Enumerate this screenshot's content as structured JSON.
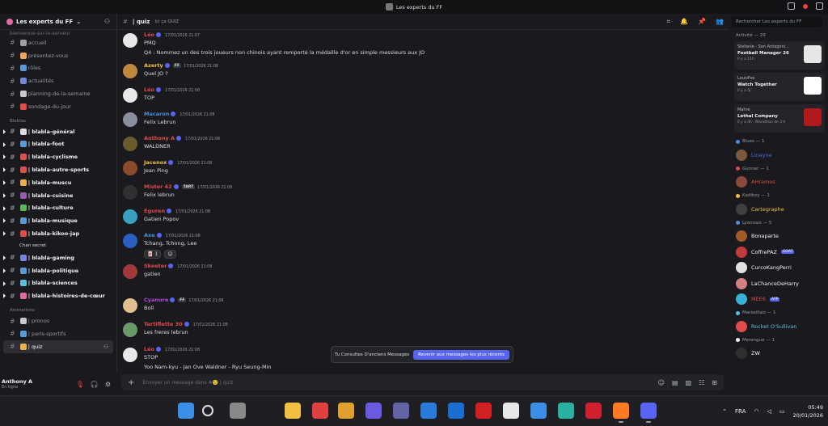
{
  "window": {
    "title": "Les experts du FF"
  },
  "server": {
    "name": "Les experts du FF"
  },
  "sidebar": {
    "cutoff": "bienvenue-sur-le-serveur",
    "top_channels": [
      {
        "label": "accueil",
        "color": "#9aa0a6"
      },
      {
        "label": "présentez-vous",
        "color": "#f2a65a"
      },
      {
        "label": "rôles",
        "color": "#5b9bd5"
      },
      {
        "label": "actualités",
        "color": "#7289da"
      },
      {
        "label": "planning-de-la-semaine",
        "color": "#c5c9ce"
      },
      {
        "label": "sondage-du-jour",
        "color": "#e14b4b"
      }
    ],
    "cat_blabla": "Blablas",
    "blabla_channels": [
      {
        "label": "| blabla-général",
        "color": "#dbdee1"
      },
      {
        "label": "| blabla-foot",
        "color": "#5b9bd5"
      },
      {
        "label": "| blabla-cyclisme",
        "color": "#d9534f"
      },
      {
        "label": "| blabla-autre-sports",
        "color": "#d9534f"
      },
      {
        "label": "| blabla-muscu",
        "color": "#f0ad4e"
      },
      {
        "label": "| blabla-cuisine",
        "color": "#9b59b6"
      },
      {
        "label": "| blabla-culture",
        "color": "#5cb85c"
      },
      {
        "label": "| blabla-musique",
        "color": "#5b9bd5"
      },
      {
        "label": "| blabla-kikoo-jap",
        "color": "#e14b4b"
      }
    ],
    "subthread": "Chan secret",
    "blabla_channels2": [
      {
        "label": "| blabla-gaming",
        "color": "#7289da"
      },
      {
        "label": "| blabla-politique",
        "color": "#5b9bd5"
      },
      {
        "label": "| blabla-sciences",
        "color": "#5bc0de"
      },
      {
        "label": "| blabla-histoires-de-cœur",
        "color": "#e06c9f"
      }
    ],
    "cat_anim": "Animations",
    "anim_channels": [
      {
        "label": "| pronos",
        "color": "#c5c9ce"
      },
      {
        "label": "| paris-sportifs",
        "color": "#5b9bd5"
      },
      {
        "label": "| quiz",
        "color": "#f0ad4e"
      }
    ]
  },
  "user": {
    "name": "Anthony A",
    "status": "En ligne"
  },
  "chat": {
    "channel": "| quiz",
    "topic": "Ici ça QUIZ",
    "search_placeholder": "Rechercher Les experts du FF",
    "messages": [
      {
        "name": "Léo",
        "color": "#e04a4a",
        "time": "17/01/2026 21:07",
        "line1": "PMQ",
        "line2": "Q4 : Nommez un des trois joueurs non chinois ayant remporté la médaille d'or en simple messieurs aux JO",
        "av": "#e8e8e8"
      },
      {
        "name": "Azerty",
        "color": "#f0c040",
        "tag": "FF",
        "time": "17/01/2026 21:08",
        "line1": "Quel JO ?",
        "av": "#c08a3e"
      },
      {
        "name": "Léo",
        "color": "#e04a4a",
        "time": "17/01/2026 21:08",
        "line1": "TOP",
        "av": "#e8e8e8"
      },
      {
        "name": "Macaron",
        "color": "#4a90d9",
        "time": "17/01/2026 21:08",
        "line1": "Felix Lebrun",
        "av": "#8a8fa0"
      },
      {
        "name": "Anthony A",
        "color": "#e04a4a",
        "time": "17/01/2026 21:08",
        "line1": "WALDNER",
        "av": "#6b5a2e"
      },
      {
        "name": "Jacenox",
        "color": "#f0c040",
        "time": "17/01/2026 21:08",
        "line1": "Jean Ping",
        "av": "#8b4a2a"
      },
      {
        "name": "Mister 42",
        "color": "#e04a4a",
        "tag": "TART",
        "time": "17/01/2026 21:08",
        "line1": "Felix lebrun",
        "av": "#303030"
      },
      {
        "name": "Eguren",
        "color": "#e04a4a",
        "time": "17/01/2026 21:08",
        "line1": "Gatien Popov",
        "av": "#3aa0c0"
      },
      {
        "name": "Axe",
        "color": "#4a90d9",
        "time": "17/01/2026 21:08",
        "line1": "Tchang, Tchong, Lee",
        "react_count": "1",
        "av": "#2a5ec0"
      },
      {
        "name": "Skeeter",
        "color": "#e04a4a",
        "time": "17/01/2026 21:08",
        "line1": "gatien",
        "av": "#a03a3a"
      },
      {
        "name": "Cyanure",
        "color": "#b04ad9",
        "tag": "FF",
        "time": "17/01/2026 21:08",
        "line1": "Boll",
        "av": "#e0c090"
      },
      {
        "name": "Tartiflette 30",
        "color": "#e04a4a",
        "time": "17/01/2026 21:08",
        "line1": "Les freres lebrun",
        "av": "#6a9a6a"
      },
      {
        "name": "Léo",
        "color": "#e04a4a",
        "time": "17/01/2026 21:08",
        "line1": "STOP",
        "line2": "Yoo Nam-kyu - Jan Ove Waldner - Ryu Seung-Min",
        "av": "#e8e8e8"
      }
    ],
    "old_banner": "Tu Consultes D'anciens Messages",
    "old_button": "Revenir aux messages les plus récents",
    "composer_placeholder": "Envoyer un message dans #🧐 | quiz"
  },
  "members": {
    "activity_header": "Activité — 29",
    "activities": [
      {
        "name": "Stefanie - Son Antagoni...",
        "title": "Football Manager 26",
        "detail": "Il y a 11h",
        "img": "#e6e6e6"
      },
      {
        "name": "LouisFox",
        "title": "Watch Together",
        "detail": "Il y a 5j",
        "img": "#ffffff"
      },
      {
        "name": "Mahre",
        "title": "Lethal Company",
        "detail": "Il y a 4h · Marathon de 3 h",
        "img": "#b01a1a"
      }
    ],
    "groups": [
      {
        "label": "Blues — 1",
        "cc": "#4a90d9",
        "members": [
          {
            "name": "Linayne",
            "color": "#4a6ad9",
            "av": "#7a5a3a"
          }
        ]
      },
      {
        "label": "Gunner — 1",
        "cc": "#e04a4a",
        "members": [
          {
            "name": "AHramos",
            "color": "#e04a4a",
            "av": "#8a4a3a"
          }
        ]
      },
      {
        "label": "Kadikoy — 1",
        "cc": "#f0c040",
        "members": [
          {
            "name": "Cartegraphe",
            "color": "#f0c040",
            "av": "#404040"
          }
        ]
      },
      {
        "label": "Lyonnais — 5",
        "cc": "#4a90d9",
        "members": [
          {
            "name": "Bonaparte",
            "color": "#f2f3f5",
            "av": "#a05a2a"
          },
          {
            "name": "CoffrePAZ",
            "color": "#f2f3f5",
            "tag": "GOAT",
            "av": "#c03a3a"
          },
          {
            "name": "CurcoKangPerri",
            "color": "#f2f3f5",
            "av": "#e0e0e0"
          },
          {
            "name": "LaChanceDeHarry",
            "color": "#f2f3f5",
            "av": "#d08080"
          },
          {
            "name": "MEE6",
            "color": "#e04a4a",
            "tag": "APP",
            "av": "#3ab0d9"
          }
        ]
      },
      {
        "label": "Marseillais — 1",
        "cc": "#5bc0de",
        "members": [
          {
            "name": "Rocket O'Sullivan",
            "color": "#5bc0de",
            "av": "#e04a4a"
          }
        ]
      },
      {
        "label": "Merengue — 1",
        "cc": "#f2f3f5",
        "members": [
          {
            "name": "ZW",
            "color": "#f2f3f5",
            "av": "#303030"
          }
        ]
      }
    ]
  },
  "taskbar": {
    "lang": "FRA",
    "time": "05:49",
    "date": "20/01/2026"
  }
}
